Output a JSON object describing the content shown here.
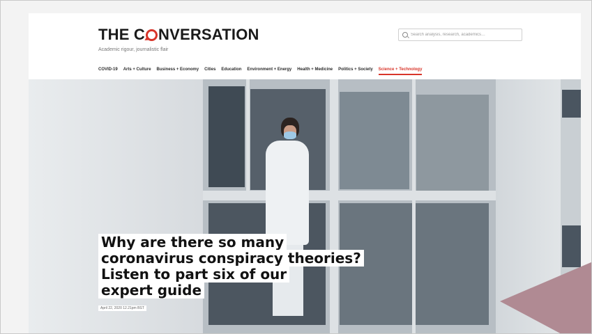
{
  "header": {
    "brand": {
      "prefix": "THE C",
      "suffix": "NVERSATION"
    },
    "tagline": "Academic rigour, journalistic flair"
  },
  "search": {
    "placeholder": "Search analysis, research, academics…"
  },
  "nav": {
    "items": [
      {
        "label": "COVID-19",
        "active": false
      },
      {
        "label": "Arts + Culture",
        "active": false
      },
      {
        "label": "Business + Economy",
        "active": false
      },
      {
        "label": "Cities",
        "active": false
      },
      {
        "label": "Education",
        "active": false
      },
      {
        "label": "Environment + Energy",
        "active": false
      },
      {
        "label": "Health + Medicine",
        "active": false
      },
      {
        "label": "Politics + Society",
        "active": false
      },
      {
        "label": "Science + Technology",
        "active": true
      }
    ]
  },
  "article": {
    "headline_lines": [
      "Why are there so many",
      "coronavirus conspiracy theories?",
      "Listen to part six of our",
      "expert guide"
    ],
    "dateline": "April 22, 2020 12.21pm BST"
  },
  "colors": {
    "accent": "#d8352a",
    "overlay": "#b08a93"
  }
}
